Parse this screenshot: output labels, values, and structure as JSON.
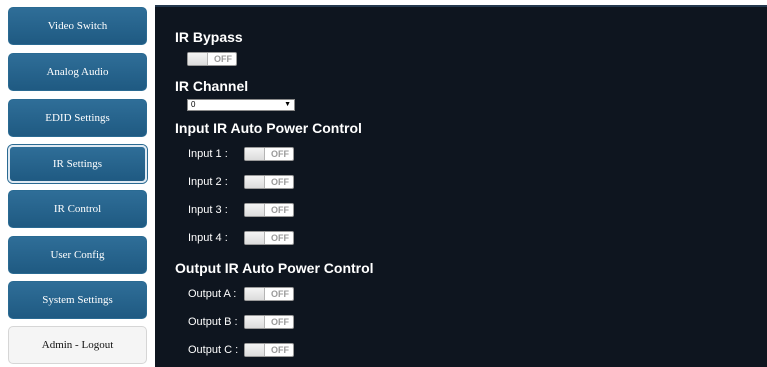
{
  "sidebar": {
    "items": [
      {
        "label": "Video Switch"
      },
      {
        "label": "Analog Audio"
      },
      {
        "label": "EDID Settings"
      },
      {
        "label": "IR Settings"
      },
      {
        "label": "IR Control"
      },
      {
        "label": "User Config"
      },
      {
        "label": "System Settings"
      },
      {
        "label": "Admin - Logout"
      }
    ]
  },
  "ir_bypass": {
    "title": "IR Bypass",
    "state": "OFF"
  },
  "ir_channel": {
    "title": "IR Channel",
    "value": "0"
  },
  "input_power": {
    "title": "Input IR Auto Power Control",
    "rows": [
      {
        "label": "Input 1 :",
        "state": "OFF"
      },
      {
        "label": "Input 2 :",
        "state": "OFF"
      },
      {
        "label": "Input 3 :",
        "state": "OFF"
      },
      {
        "label": "Input 4 :",
        "state": "OFF"
      }
    ]
  },
  "output_power": {
    "title": "Output IR Auto Power Control",
    "rows": [
      {
        "label": "Output A :",
        "state": "OFF"
      },
      {
        "label": "Output B :",
        "state": "OFF"
      },
      {
        "label": "Output C :",
        "state": "OFF"
      }
    ]
  }
}
